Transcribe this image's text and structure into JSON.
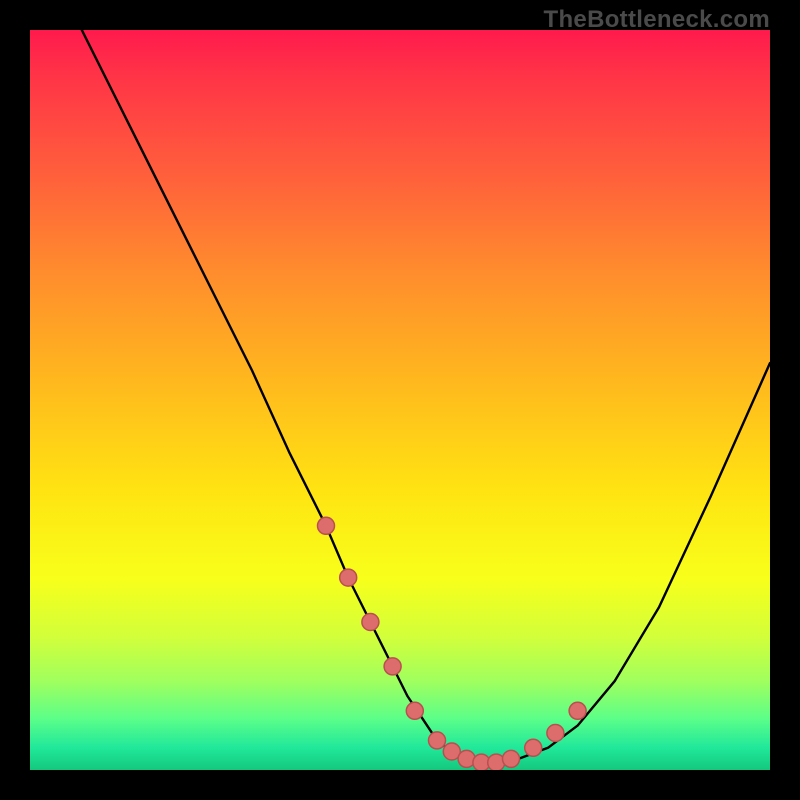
{
  "watermark": "TheBottleneck.com",
  "chart_data": {
    "type": "line",
    "title": "",
    "xlabel": "",
    "ylabel": "",
    "xlim": [
      0,
      100
    ],
    "ylim": [
      0,
      100
    ],
    "series": [
      {
        "name": "bottleneck-curve",
        "x": [
          7,
          12,
          18,
          24,
          30,
          35,
          40,
          43,
          46,
          49,
          51,
          53,
          55,
          57,
          59,
          61,
          63,
          66,
          70,
          74,
          79,
          85,
          92,
          100
        ],
        "y": [
          100,
          90,
          78,
          66,
          54,
          43,
          33,
          26,
          20,
          14,
          10,
          7,
          4,
          2.5,
          1.5,
          1,
          1,
          1.5,
          3,
          6,
          12,
          22,
          37,
          55
        ]
      }
    ],
    "markers": {
      "name": "highlight-dots",
      "x": [
        40,
        43,
        46,
        49,
        52,
        55,
        57,
        59,
        61,
        63,
        65,
        68,
        71,
        74
      ],
      "y": [
        33,
        26,
        20,
        14,
        8,
        4,
        2.5,
        1.5,
        1,
        1,
        1.5,
        3,
        5,
        8
      ]
    },
    "colors": {
      "curve": "#000000",
      "marker_fill": "#dd6d6d",
      "marker_stroke": "#b94f4f"
    }
  }
}
